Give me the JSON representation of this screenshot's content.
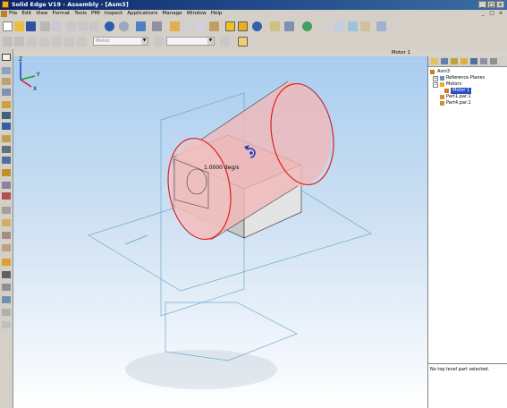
{
  "window": {
    "title": "Solid Edge V19 - Assembly - [Asm3]"
  },
  "menu": {
    "items": [
      "File",
      "Edit",
      "View",
      "Format",
      "Tools",
      "PMI",
      "Inspect",
      "Applications",
      "Manage",
      "Window",
      "Help"
    ]
  },
  "toolbar2": {
    "combo1": "Motor",
    "combo2": ""
  },
  "document": {
    "title": "Motor 1"
  },
  "viewport": {
    "motor_value": "1.0000 deg/s"
  },
  "triad": {
    "z": "Z",
    "y": "Y",
    "x": "X"
  },
  "pathfinder": {
    "tree": [
      {
        "label": "Asm3",
        "icon": "assembly-icon",
        "level": 0
      },
      {
        "label": "Reference Planes",
        "icon": "reference-planes-icon",
        "level": 1
      },
      {
        "label": "Motors",
        "icon": "motors-folder-icon",
        "level": 1
      },
      {
        "label": "Motor 1",
        "icon": "motor-icon",
        "level": 2,
        "selected": true
      },
      {
        "label": "Part1.par:1",
        "icon": "part-icon",
        "level": 1
      },
      {
        "label": "Part4.par:1",
        "icon": "part-icon",
        "level": 1
      }
    ],
    "status": "No top level part selected."
  },
  "colors": {
    "accent_title": "#0a246a",
    "selection": "#2850c0",
    "motor_edge": "#e02020",
    "cylinder_fill": "#f0b8b8"
  }
}
